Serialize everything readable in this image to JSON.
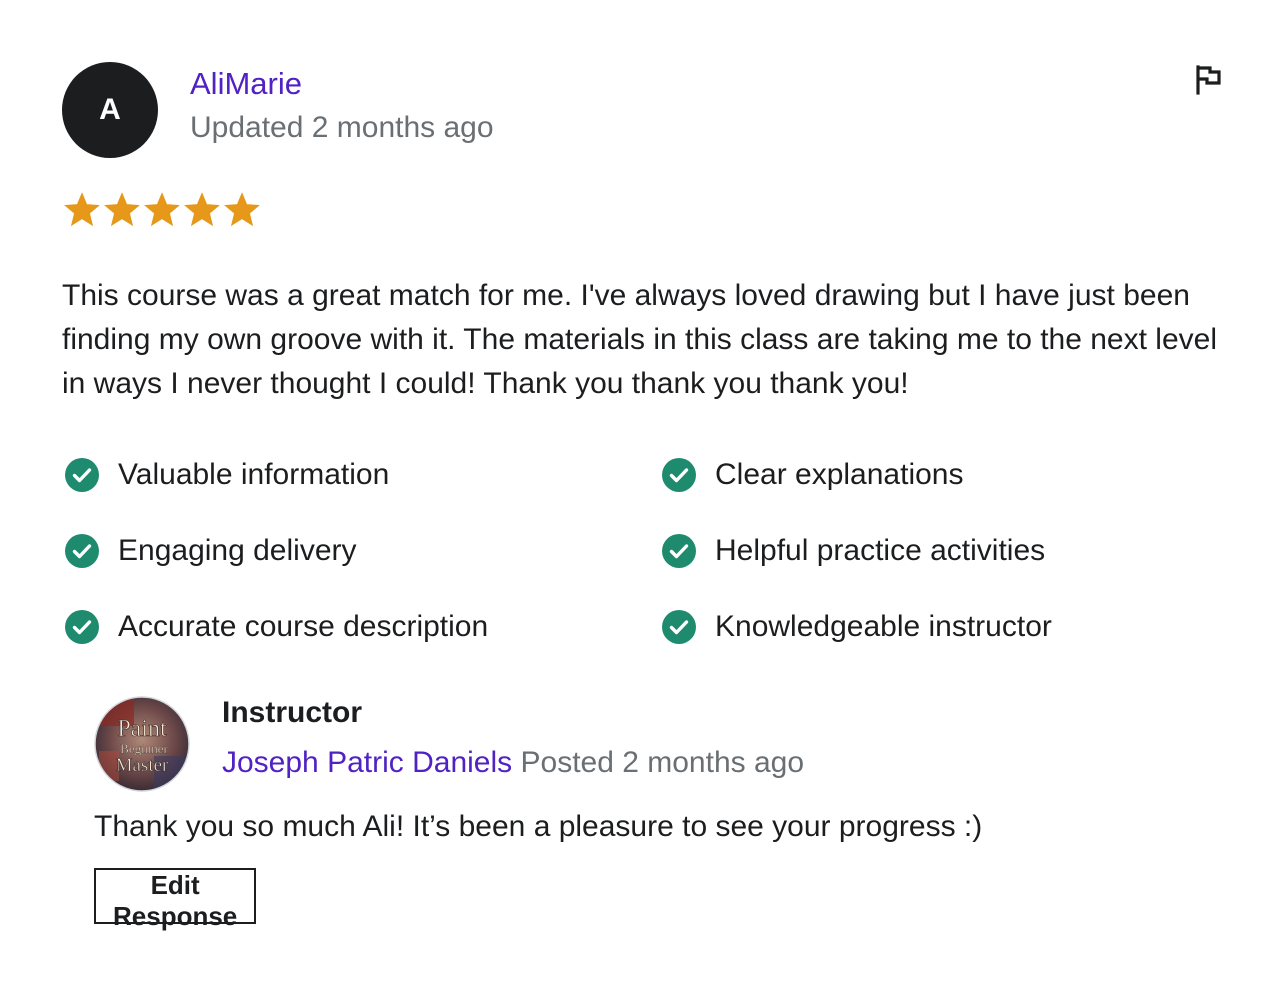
{
  "review": {
    "avatar_initial": "A",
    "reviewer_name": "AliMarie",
    "date": "Updated 2 months ago",
    "rating": 5,
    "rating_max": 5,
    "text": "This course was a great match for me. I've always loved drawing but I have just been finding my own groove with it. The materials in this class are taking me to the next level in ways I never thought I could! Thank you thank you thank you!",
    "attributes": [
      {
        "label": "Valuable information",
        "icon": "check-circle-icon"
      },
      {
        "label": "Clear explanations",
        "icon": "check-circle-icon"
      },
      {
        "label": "Engaging delivery",
        "icon": "check-circle-icon"
      },
      {
        "label": "Helpful practice activities",
        "icon": "check-circle-icon"
      },
      {
        "label": "Accurate course description",
        "icon": "check-circle-icon"
      },
      {
        "label": "Knowledgeable instructor",
        "icon": "check-circle-icon"
      }
    ],
    "report_icon": "flag-icon"
  },
  "response": {
    "role": "Instructor",
    "name": "Joseph Patric Daniels",
    "date": "Posted 2 months ago",
    "text": "Thank you so much Ali! It’s been a pleasure to see your progress :)",
    "edit_label": "Edit Response",
    "avatar_text": [
      "Paint",
      "Beginner",
      "Master"
    ]
  },
  "colors": {
    "accent": "#5022c3",
    "star": "#e59819",
    "check": "#1e8a6e",
    "muted": "#6a6f73",
    "text": "#1c1d1f"
  }
}
